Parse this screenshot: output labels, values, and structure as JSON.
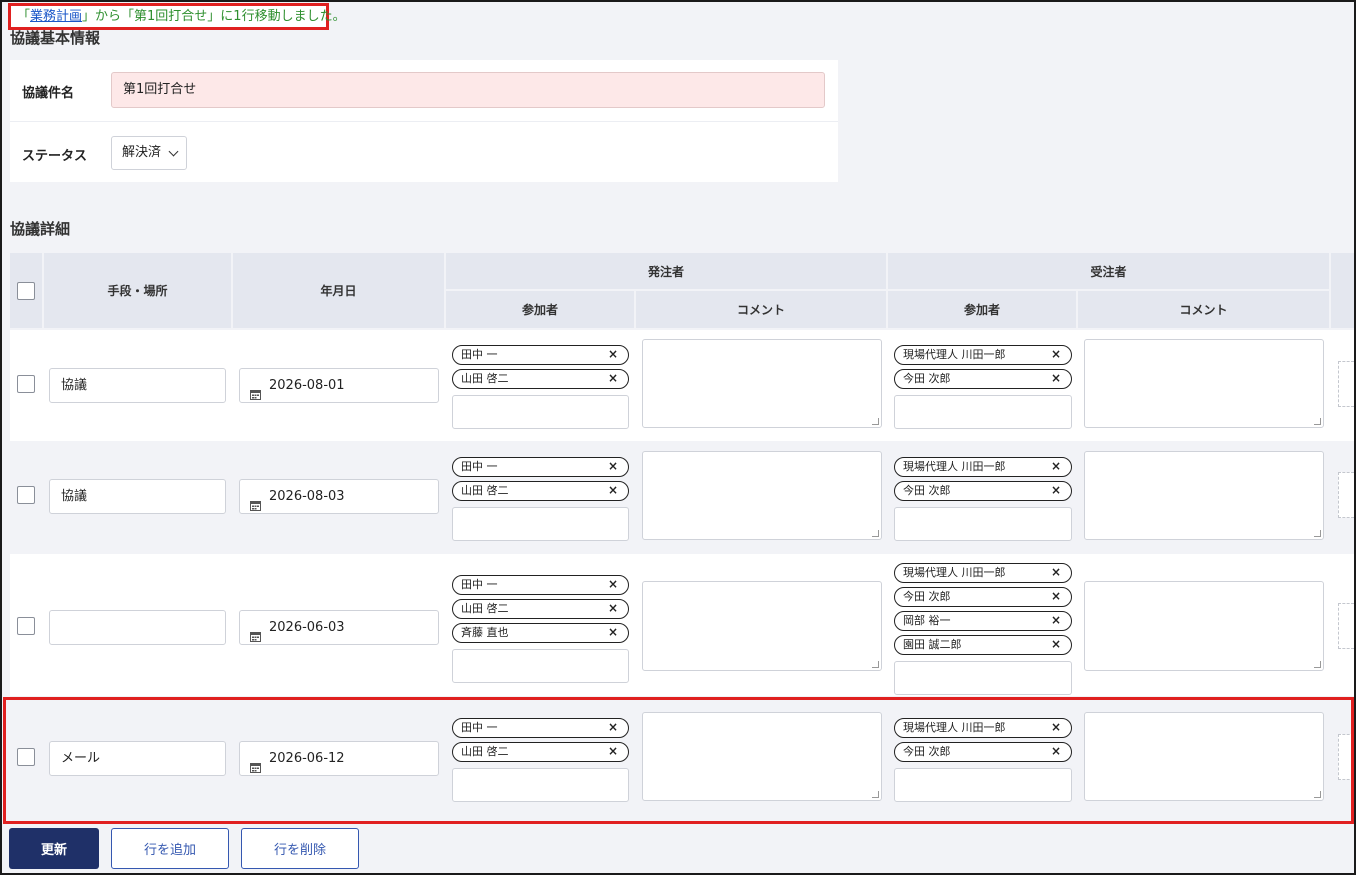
{
  "notice": {
    "prefix": "「",
    "link": "業務計画",
    "suffix": "」から「第1回打合せ」に1行移動しました。"
  },
  "basic_section": {
    "title": "協議基本情報",
    "name_label": "協議件名",
    "name_value": "第1回打合せ",
    "status_label": "ステータス",
    "status_value": "解決済"
  },
  "detail_section": {
    "title": "協議詳細",
    "headers": {
      "method": "手段・場所",
      "date": "年月日",
      "orderer": "発注者",
      "contractor": "受注者",
      "participants": "参加者",
      "comment": "コメント"
    },
    "rows": [
      {
        "method": "協議",
        "date": "2026-08-01",
        "orderer_participants": [
          "田中 一",
          "山田 啓二"
        ],
        "contractor_participants": [
          "現場代理人 川田一郎",
          "今田 次郎"
        ]
      },
      {
        "method": "協議",
        "date": "2026-08-03",
        "orderer_participants": [
          "田中 一",
          "山田 啓二"
        ],
        "contractor_participants": [
          "現場代理人 川田一郎",
          "今田 次郎"
        ]
      },
      {
        "method": "",
        "date": "2026-06-03",
        "orderer_participants": [
          "田中 一",
          "山田 啓二",
          "斉藤 直也"
        ],
        "contractor_participants": [
          "現場代理人 川田一郎",
          "今田 次郎",
          "岡部 裕一",
          "園田 誠二郎"
        ]
      },
      {
        "method": "メール",
        "date": "2026-06-12",
        "orderer_participants": [
          "田中 一",
          "山田 啓二"
        ],
        "contractor_participants": [
          "現場代理人 川田一郎",
          "今田 次郎"
        ]
      }
    ]
  },
  "tag_remove_glyph": "×",
  "buttons": {
    "update": "更新",
    "add_row": "行を追加",
    "delete_row": "行を削除"
  },
  "colors": {
    "primary": "#1f3068",
    "alert_border": "#e02020",
    "notice_text": "#2e8f2e",
    "link": "#1a56c8"
  }
}
